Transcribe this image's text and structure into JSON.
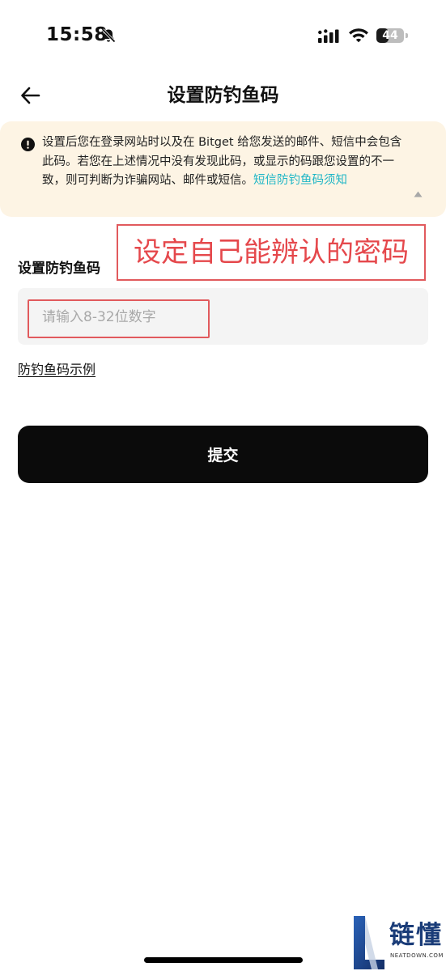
{
  "status_bar": {
    "time": "15:58",
    "battery_level": "44",
    "battery_percent": 44,
    "icons": [
      "bell-slash-icon",
      "cellular-signal-icon",
      "wifi-icon",
      "battery-icon"
    ]
  },
  "header": {
    "title": "设置防钓鱼码",
    "back_icon": "arrow-left-icon"
  },
  "notice": {
    "icon": "exclamation-circle-icon",
    "text": "设置后您在登录网站时以及在 Bitget 给您发送的邮件、短信中会包含此码。若您在上述情况中没有发现此码，或显示的码跟您设置的不一致，则可判断为诈骗网站、邮件或短信。",
    "link_text": "短信防钓鱼码须知",
    "collapse_icon": "caret-up-icon"
  },
  "annotation": {
    "text": "设定自己能辨认的密码",
    "color": "#e5484c"
  },
  "form": {
    "label": "设置防钓鱼码",
    "input_placeholder": "请输入8-32位数字",
    "input_value": "",
    "example_link": "防钓鱼码示例",
    "submit_label": "提交"
  },
  "watermark": {
    "brand_cn": "链懂",
    "brand_en": "NEATDOWN.COM"
  },
  "colors": {
    "accent_link": "#1fb6c6",
    "notice_bg": "#fdf4e4",
    "button_bg": "#0b0b0b",
    "annotation_red": "#e5484c"
  }
}
